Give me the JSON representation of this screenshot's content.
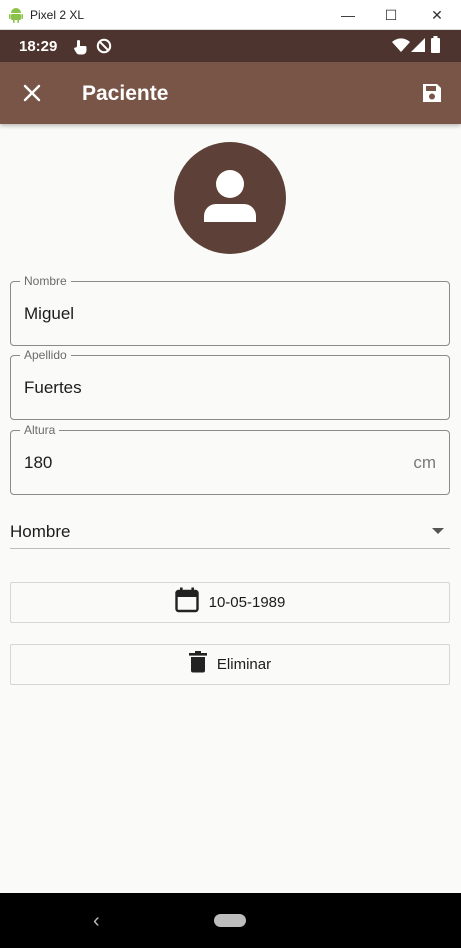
{
  "window": {
    "title": "Pixel 2 XL",
    "minimize_glyph": "—",
    "maximize_glyph": "☐",
    "close_glyph": "✕"
  },
  "status_bar": {
    "time": "18:29",
    "icons": [
      "touch-icon",
      "do-not-disturb-icon",
      "wifi-icon",
      "signal-icon",
      "battery-icon"
    ]
  },
  "app_bar": {
    "title": "Paciente",
    "leading_icon": "close-icon",
    "trailing_icon": "save-icon",
    "color": "#795548"
  },
  "avatar": {
    "icon": "person-icon",
    "color": "#5d4037"
  },
  "form": {
    "nombre": {
      "label": "Nombre",
      "value": "Miguel"
    },
    "apellido": {
      "label": "Apellido",
      "value": "Fuertes"
    },
    "altura": {
      "label": "Altura",
      "value": "180",
      "suffix": "cm"
    },
    "sexo": {
      "value": "Hombre"
    },
    "fecha": {
      "value": "10-05-1989",
      "icon": "calendar-icon"
    },
    "eliminar": {
      "label": "Eliminar",
      "icon": "trash-icon"
    }
  },
  "nav_bar": {
    "back_glyph": "‹"
  }
}
